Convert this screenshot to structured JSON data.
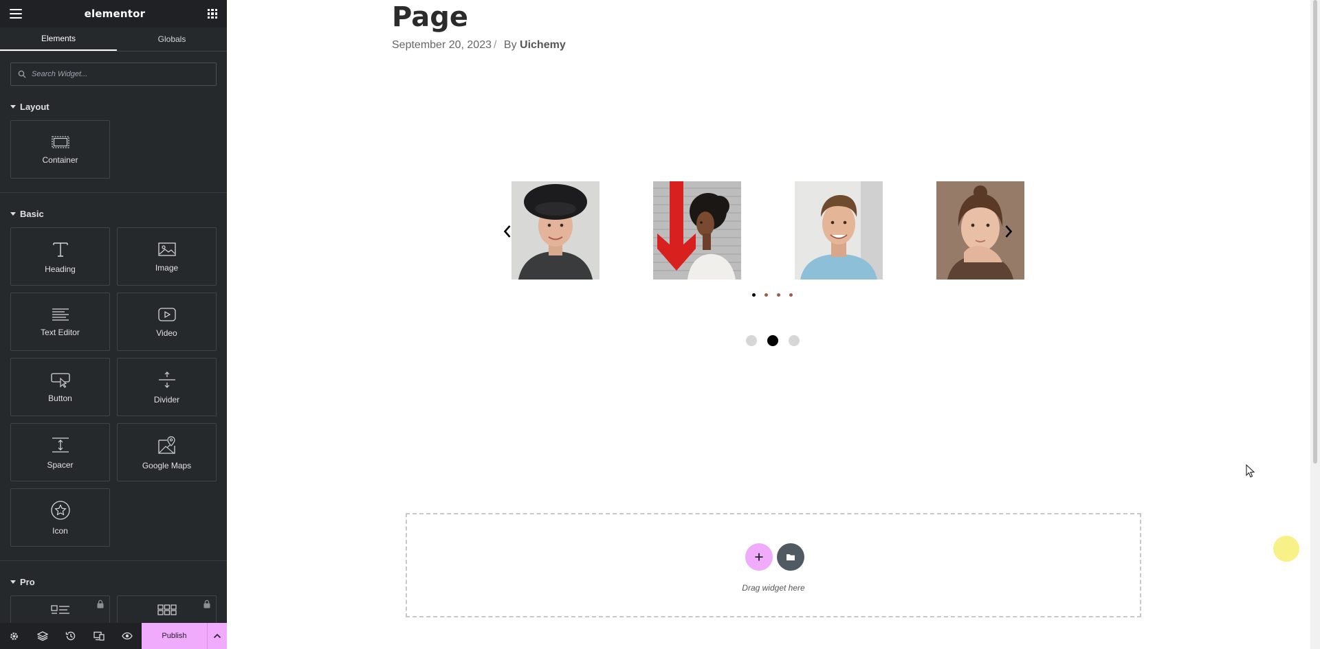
{
  "sidebar": {
    "logo": "elementor",
    "tabs": [
      {
        "label": "Elements",
        "active": true
      },
      {
        "label": "Globals",
        "active": false
      }
    ],
    "search": {
      "placeholder": "Search Widget..."
    },
    "sections": {
      "layout": {
        "title": "Layout",
        "widgets": [
          {
            "label": "Container",
            "icon": "container-icon"
          }
        ]
      },
      "basic": {
        "title": "Basic",
        "widgets": [
          {
            "label": "Heading",
            "icon": "heading-icon"
          },
          {
            "label": "Image",
            "icon": "image-icon"
          },
          {
            "label": "Text Editor",
            "icon": "text-editor-icon"
          },
          {
            "label": "Video",
            "icon": "video-icon"
          },
          {
            "label": "Button",
            "icon": "button-icon"
          },
          {
            "label": "Divider",
            "icon": "divider-icon"
          },
          {
            "label": "Spacer",
            "icon": "spacer-icon"
          },
          {
            "label": "Google Maps",
            "icon": "google-maps-icon"
          },
          {
            "label": "Icon",
            "icon": "star-icon"
          }
        ]
      },
      "pro": {
        "title": "Pro"
      }
    },
    "bottombar": {
      "publish_label": "Publish"
    }
  },
  "page": {
    "title": "Page",
    "date": "September 20, 2023",
    "separator": "/",
    "by_label": "By",
    "author": "Uichemy"
  },
  "carousel": {
    "slides": [
      {
        "subject": "young man with black hat"
      },
      {
        "subject": "woman with afro hair, red arrow backdrop"
      },
      {
        "subject": "smiling man, light blue shirt"
      },
      {
        "subject": "woman resting chin on hand"
      }
    ],
    "small_dots_active": 1,
    "small_dots_count": 4,
    "big_dots_active": 2,
    "big_dots_count": 3
  },
  "dropzone": {
    "text": "Drag widget here"
  },
  "colors": {
    "panel_bg": "#26292c",
    "accent": "#f0abfc",
    "folder_btn": "#515962"
  }
}
